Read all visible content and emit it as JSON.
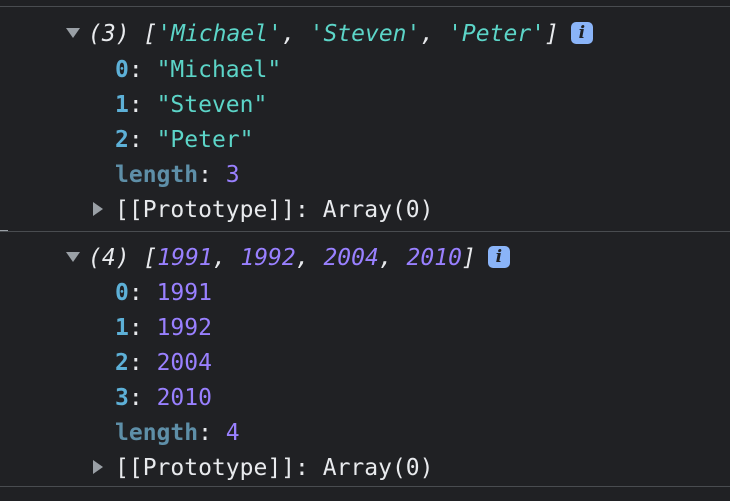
{
  "console": {
    "entries": [
      {
        "summary": {
          "count": "(3)",
          "open_bracket": "[",
          "items": [
            "'Michael'",
            "'Steven'",
            "'Peter'"
          ],
          "separator": ", ",
          "close_bracket": "]"
        },
        "props": [
          {
            "key": "0",
            "value": "\"Michael\""
          },
          {
            "key": "1",
            "value": "\"Steven\""
          },
          {
            "key": "2",
            "value": "\"Peter\""
          }
        ],
        "length_key": "length",
        "length_value": "3",
        "prototype_key": "[[Prototype]]",
        "prototype_value": "Array(0)"
      },
      {
        "summary": {
          "count": "(4)",
          "open_bracket": "[",
          "items": [
            "1991",
            "1992",
            "2004",
            "2010"
          ],
          "separator": ", ",
          "close_bracket": "]"
        },
        "props": [
          {
            "key": "0",
            "value": "1991"
          },
          {
            "key": "1",
            "value": "1992"
          },
          {
            "key": "2",
            "value": "2004"
          },
          {
            "key": "3",
            "value": "2010"
          }
        ],
        "length_key": "length",
        "length_value": "4",
        "prototype_key": "[[Prototype]]",
        "prototype_value": "Array(0)"
      }
    ],
    "colon": ": ",
    "info_glyph": "i",
    "colors": {
      "background": "#202124",
      "string": "#5cd5c8",
      "number": "#9980ff",
      "key": "#5db0d7",
      "info_badge": "#8ab4f8"
    }
  }
}
